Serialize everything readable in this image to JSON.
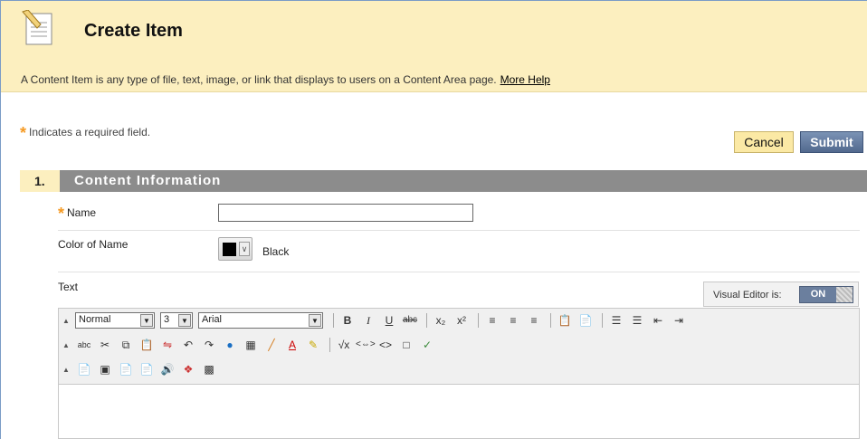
{
  "header": {
    "title": "Create Item",
    "description": "A Content Item is any type of file, text, image, or link that displays to users on a Content Area page.",
    "help_link": "More Help"
  },
  "required_note": "Indicates a required field.",
  "actions": {
    "cancel": "Cancel",
    "submit": "Submit"
  },
  "section": {
    "number": "1.",
    "title": "Content Information"
  },
  "fields": {
    "name_label": "Name",
    "name_value": "",
    "color_label": "Color of Name",
    "color_value": "Black",
    "text_label": "Text"
  },
  "visual_editor": {
    "label": "Visual Editor is:",
    "state": "ON"
  },
  "toolbar": {
    "format": "Normal",
    "size": "3",
    "font": "Arial"
  },
  "colors": {
    "header_bg": "#fcefbf",
    "section_bar": "#8c8c8c",
    "submit": "#52698e",
    "required_star": "#f59a23"
  }
}
